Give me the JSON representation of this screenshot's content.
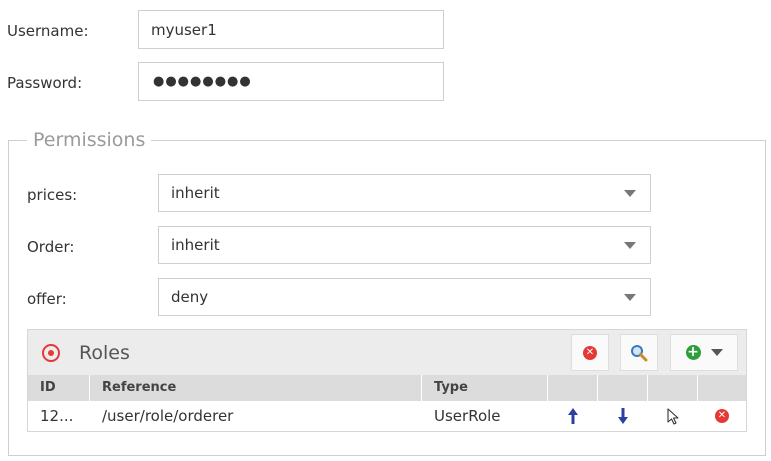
{
  "form": {
    "username_label": "Username:",
    "username_value": "myuser1",
    "password_label": "Password:",
    "password_value": "●●●●●●●●"
  },
  "permissions": {
    "legend": "Permissions",
    "rows": [
      {
        "label": "prices:",
        "value": "inherit"
      },
      {
        "label": "Order:",
        "value": "inherit"
      },
      {
        "label": "offer:",
        "value": "deny"
      }
    ]
  },
  "roles": {
    "title": "Roles",
    "columns": [
      "ID",
      "Reference",
      "Type"
    ],
    "rows": [
      {
        "id": "12...",
        "reference": "/user/role/orderer",
        "type": "UserRole"
      }
    ]
  },
  "icons": {
    "roles": "target-icon",
    "clear": "circle-x-icon",
    "search": "magnifier-icon",
    "add": "circle-plus-icon",
    "move_up": "arrow-up-icon",
    "move_down": "arrow-down-icon",
    "select": "cursor-icon",
    "remove": "circle-x-icon"
  },
  "colors": {
    "danger": "#e53935",
    "success": "#2e9d3a",
    "arrow": "#2f3f9e",
    "legend": "#9a9a9a"
  }
}
